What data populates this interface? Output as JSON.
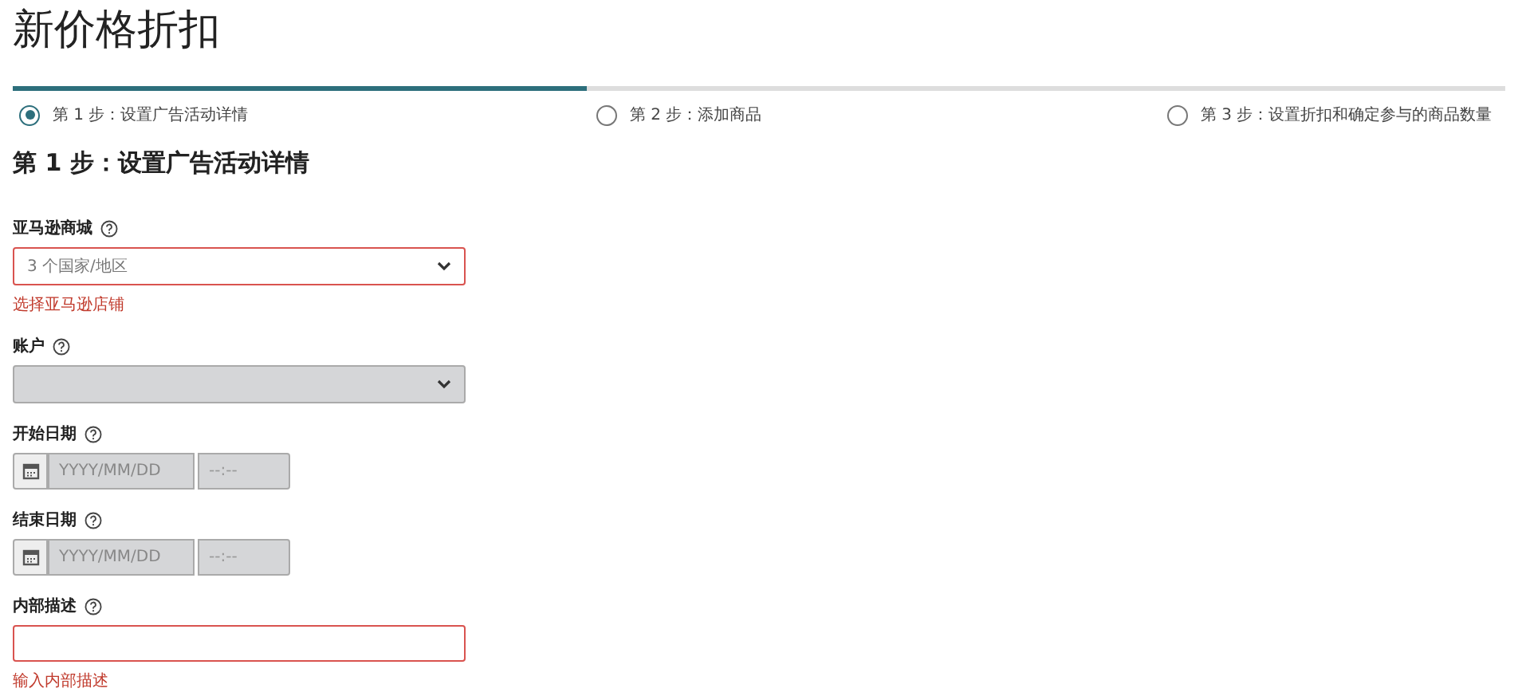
{
  "title": "新价格折扣",
  "progress": {
    "level": 0.385
  },
  "steps": [
    {
      "label": "第 1 步：设置广告活动详情",
      "selected": true
    },
    {
      "label": "第 2 步：添加商品",
      "selected": false
    },
    {
      "label": "第 3 步：设置折扣和确定参与的商品数量",
      "selected": false
    }
  ],
  "section_heading": "第 1 步：设置广告活动详情",
  "fields": [
    {
      "kind": "select",
      "label": "亚马逊商城",
      "value": "3 个国家/地区",
      "invalid": true,
      "error": "选择亚马逊店铺"
    },
    {
      "kind": "select",
      "label": "账户",
      "disabled": true
    },
    {
      "kind": "datetime",
      "label": "开始日期",
      "date_placeholder": "YYYY/MM/DD",
      "time_placeholder": "--:--",
      "disabled": true
    },
    {
      "kind": "datetime",
      "label": "结束日期",
      "date_placeholder": "YYYY/MM/DD",
      "time_placeholder": "--:--",
      "disabled": true
    },
    {
      "kind": "text",
      "label": "内部描述",
      "invalid": true,
      "error": "输入内部描述"
    }
  ]
}
